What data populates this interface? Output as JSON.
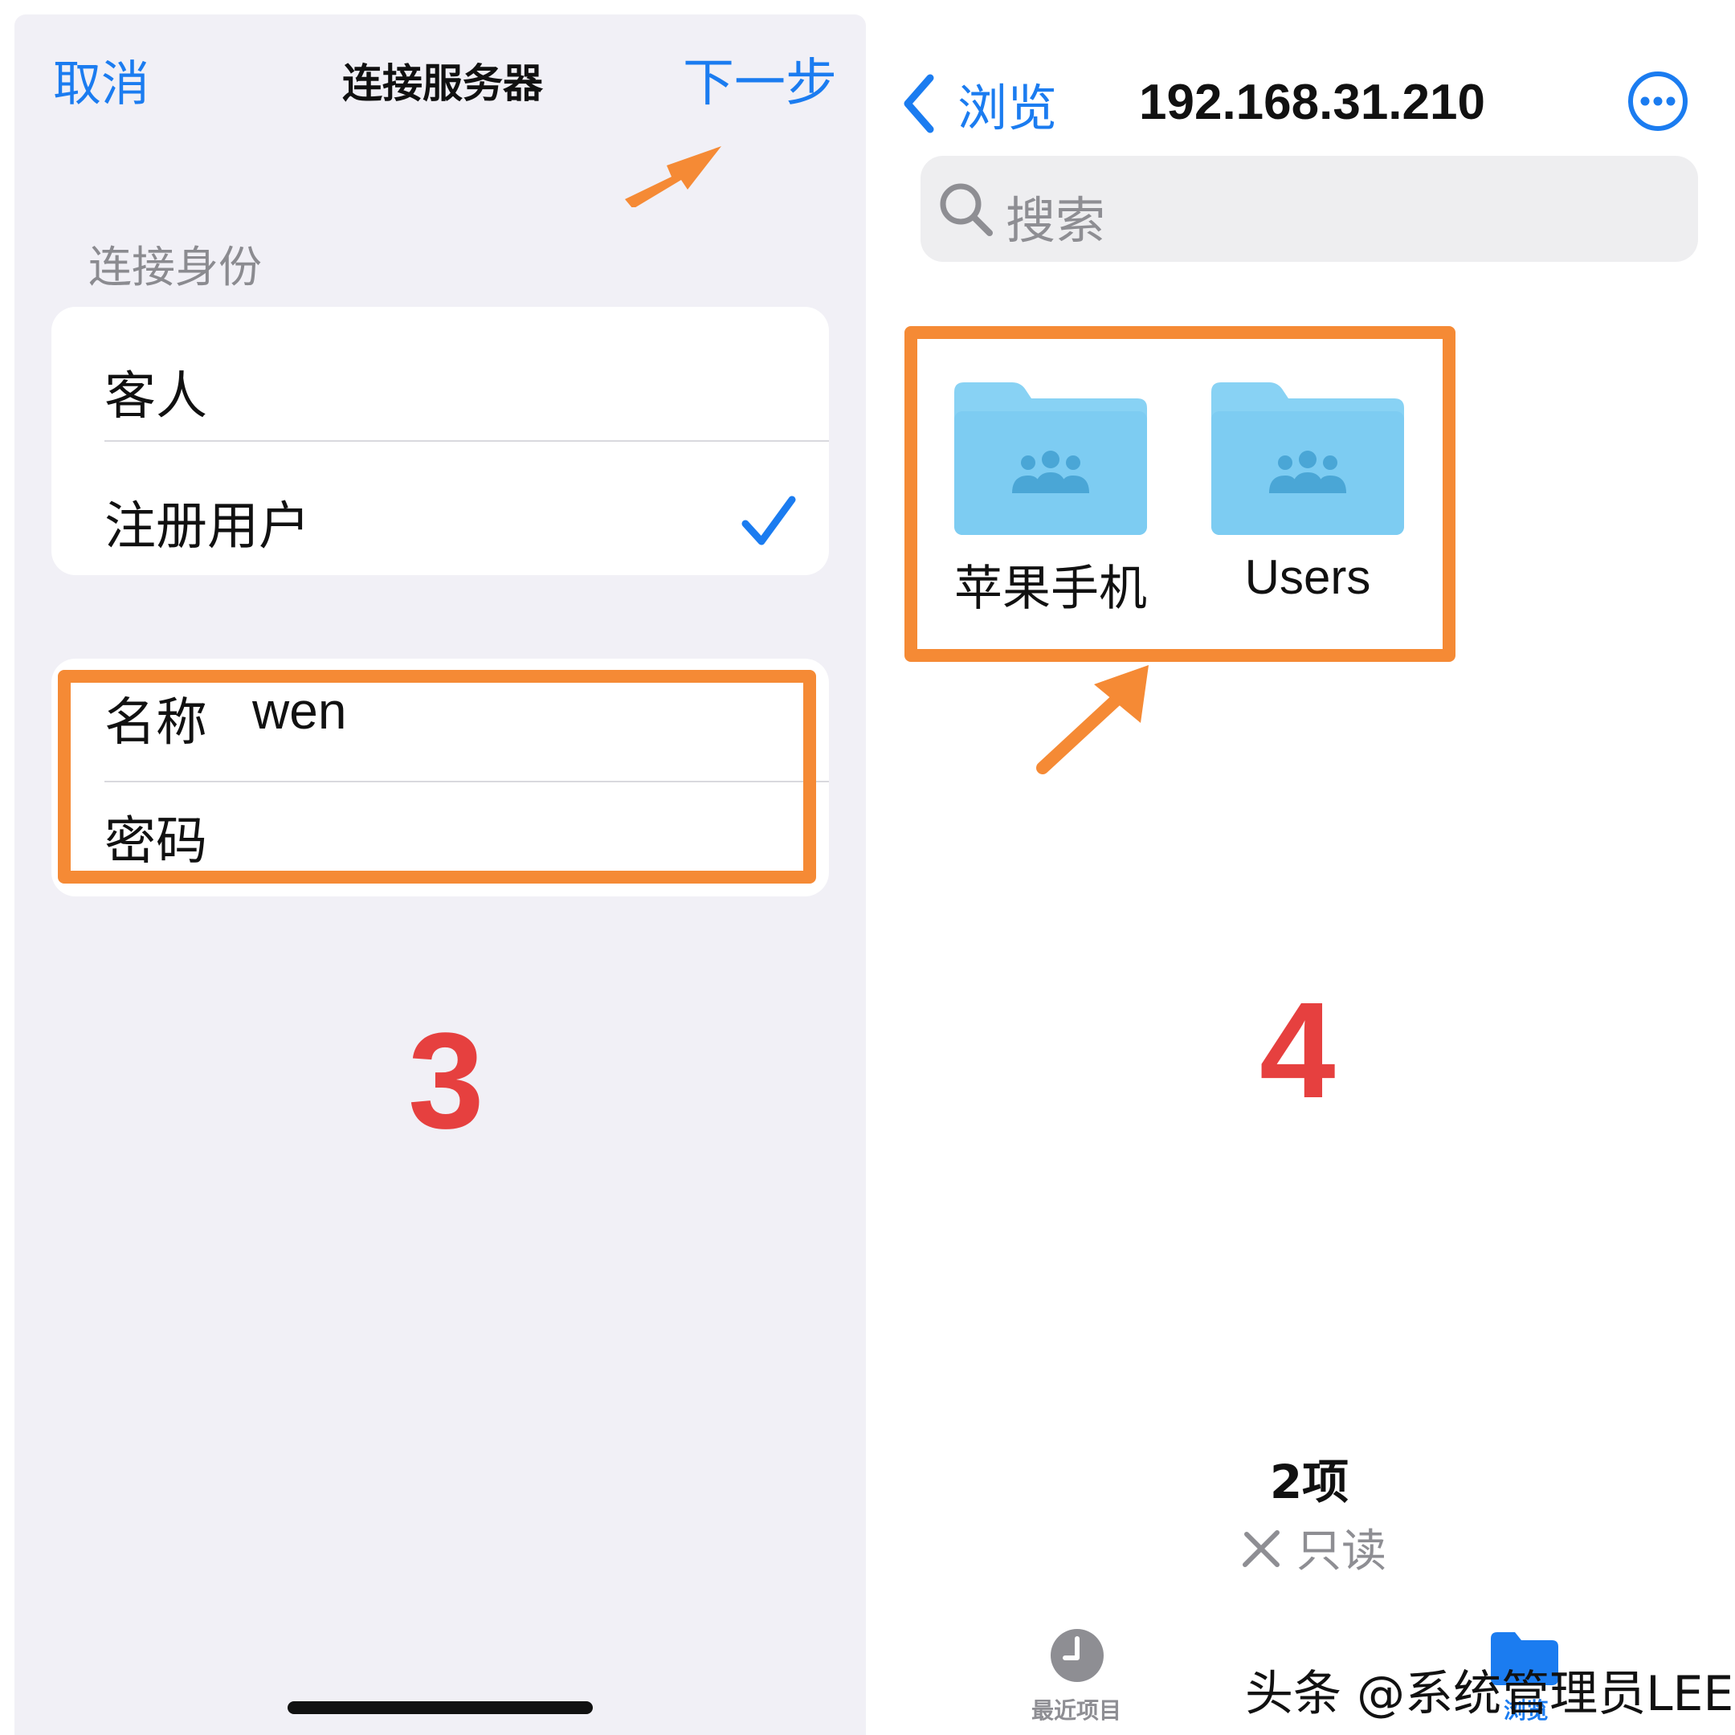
{
  "left_screen": {
    "nav": {
      "cancel": "取消",
      "title": "连接服务器",
      "next": "下一步"
    },
    "section_label": "连接身份",
    "identity_options": [
      {
        "label": "客人",
        "selected": false
      },
      {
        "label": "注册用户",
        "selected": true
      }
    ],
    "credentials": {
      "name_label": "名称",
      "name_value": "wen",
      "password_label": "密码"
    },
    "step_number": "3"
  },
  "right_screen": {
    "nav": {
      "back_label": "浏览",
      "title": "192.168.31.210"
    },
    "search": {
      "placeholder": "搜索"
    },
    "folders": [
      {
        "name": "苹果手机"
      },
      {
        "name": "Users"
      }
    ],
    "step_number": "4",
    "footer": {
      "count": "2项",
      "status": "只读"
    },
    "tab_bar": {
      "recents_label": "最近项目",
      "browse_label": "浏览"
    }
  },
  "watermark": "头条 @系统管理员LEE",
  "colors": {
    "accent": "#1b7cf0",
    "highlight": "#f58a35",
    "step_number": "#e6403f",
    "folder": "#7dccf2"
  },
  "icons": [
    "chevron-left-icon",
    "more-circle-icon",
    "search-icon",
    "shared-folder-icon",
    "checkmark-icon",
    "clock-icon",
    "folder-tab-icon",
    "readonly-pencil-icon",
    "arrow-icon"
  ]
}
